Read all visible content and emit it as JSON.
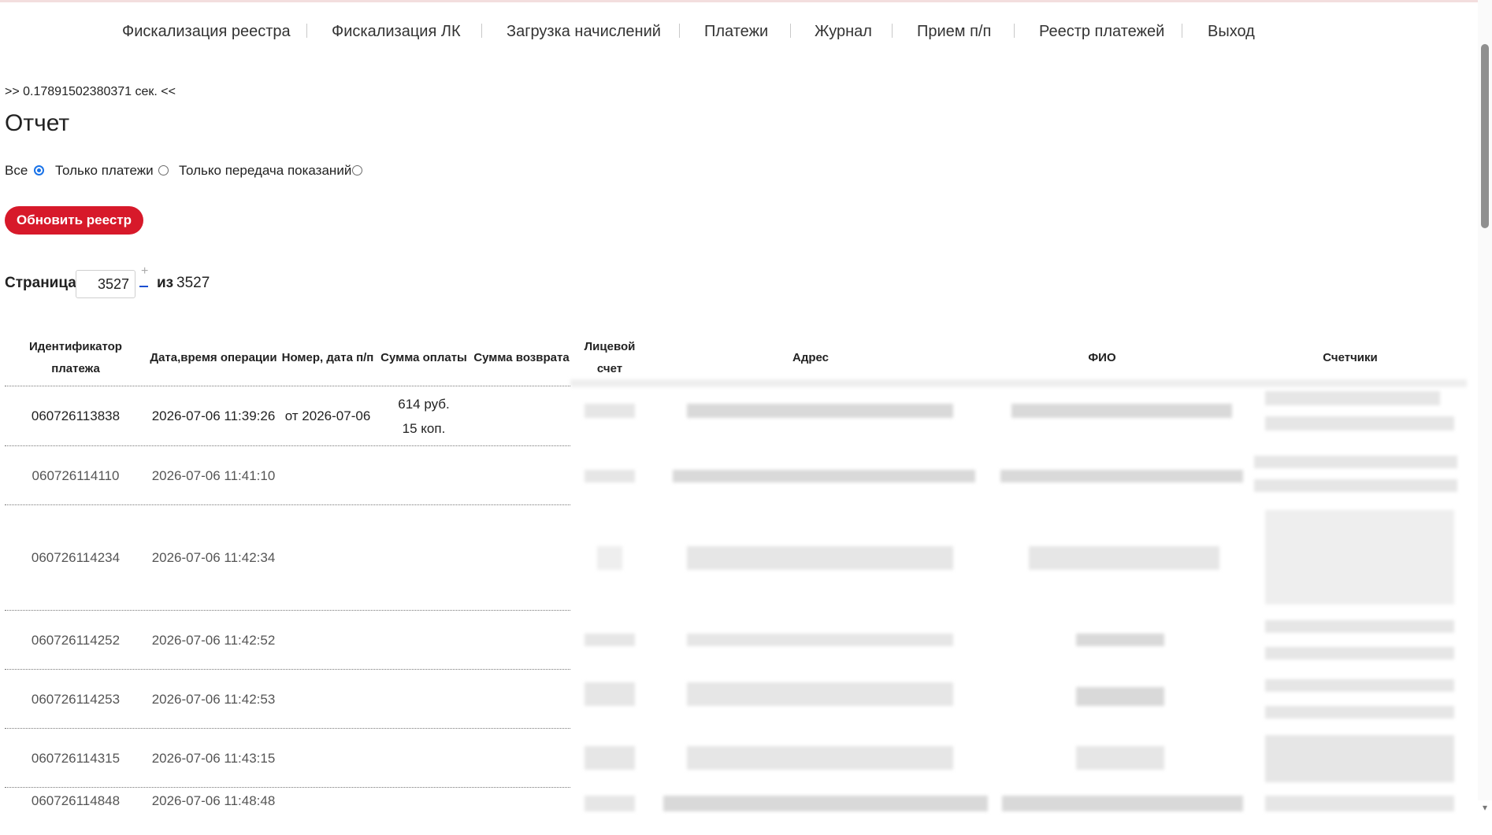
{
  "nav": {
    "items": [
      {
        "label": "Фискализация реестра"
      },
      {
        "label": "Фискализация ЛК"
      },
      {
        "label": "Загрузка начислений"
      },
      {
        "label": "Платежи"
      },
      {
        "label": "Журнал"
      },
      {
        "label": "Прием п/п"
      },
      {
        "label": "Реестр платежей"
      },
      {
        "label": "Выход"
      }
    ]
  },
  "timing": ">> 0.17891502380371 сек. <<",
  "title": "Отчет",
  "filters": {
    "all": "Все",
    "payments_only": "Только платежи",
    "readings_only": "Только передача показаний",
    "selected": "all"
  },
  "refresh_button": "Обновить реестр",
  "pager": {
    "label": "Страница",
    "current": "3527",
    "of_label": "из",
    "total": "3527",
    "stepper_up": "+"
  },
  "table": {
    "columns": [
      "Идентификатор платежа",
      "Дата,время операции",
      "Номер, дата п/п",
      "Сумма оплаты",
      "Сумма возврата",
      "Лицевой счет",
      "Адрес",
      "ФИО",
      "Счетчики"
    ],
    "rows": [
      {
        "id": "060726113838",
        "datetime": "2026-07-06 11:39:26",
        "pp": "от 2026-07-06",
        "amount": "614 руб. 15 коп.",
        "refund": ""
      },
      {
        "id": "060726114110",
        "datetime": "2026-07-06 11:41:10",
        "pp": "",
        "amount": "",
        "refund": ""
      },
      {
        "id": "060726114234",
        "datetime": "2026-07-06 11:42:34",
        "pp": "",
        "amount": "",
        "refund": ""
      },
      {
        "id": "060726114252",
        "datetime": "2026-07-06 11:42:52",
        "pp": "",
        "amount": "",
        "refund": ""
      },
      {
        "id": "060726114253",
        "datetime": "2026-07-06 11:42:53",
        "pp": "",
        "amount": "",
        "refund": ""
      },
      {
        "id": "060726114315",
        "datetime": "2026-07-06 11:43:15",
        "pp": "",
        "amount": "",
        "refund": ""
      },
      {
        "id": "060726114848",
        "datetime": "2026-07-06 11:48:48",
        "pp": "",
        "amount": "",
        "refund": ""
      }
    ]
  },
  "colors": {
    "accent": "#d7192a",
    "radio": "#1a73e8"
  }
}
